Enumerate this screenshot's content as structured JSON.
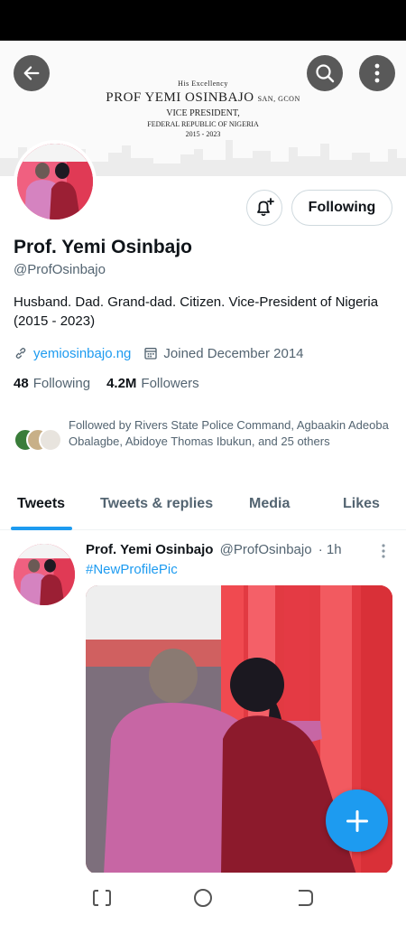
{
  "banner": {
    "honorific": "His Excellency",
    "name": "PROF YEMI OSINBAJO",
    "name_suffix": "SAN, GCON",
    "role": "VICE PRESIDENT,",
    "country": "FEDERAL REPUBLIC OF NIGERIA",
    "years": "2015 - 2023"
  },
  "header_icons": {
    "back": "arrow-left-icon",
    "search": "search-icon",
    "more": "more-vertical-icon"
  },
  "actions": {
    "notify_icon": "bell-plus-icon",
    "following_label": "Following"
  },
  "profile": {
    "name": "Prof. Yemi Osinbajo",
    "handle": "@ProfOsinbajo",
    "bio": "Husband. Dad. Grand-dad. Citizen. Vice-President of Nigeria (2015 - 2023)",
    "website": "yemiosinbajo.ng",
    "joined": "Joined December 2014",
    "following_count": "48",
    "following_label": "Following",
    "followers_count": "4.2M",
    "followers_label": "Followers",
    "followed_by": "Followed by Rivers State Police Command, Agbaakin Adeoba Obalagbe, Abidoye Thomas Ibukun, and 25 others"
  },
  "tabs": [
    {
      "label": "Tweets",
      "active": true
    },
    {
      "label": "Tweets & replies",
      "active": false
    },
    {
      "label": "Media",
      "active": false
    },
    {
      "label": "Likes",
      "active": false
    }
  ],
  "tweet": {
    "author_name": "Prof. Yemi Osinbajo",
    "author_handle": "@ProfOsinbajo",
    "time": "· 1h",
    "text": "#NewProfilePic"
  },
  "fab_icon": "plus-icon",
  "colors": {
    "accent": "#1d9bf0",
    "text_primary": "#0f1419",
    "text_secondary": "#536471"
  }
}
